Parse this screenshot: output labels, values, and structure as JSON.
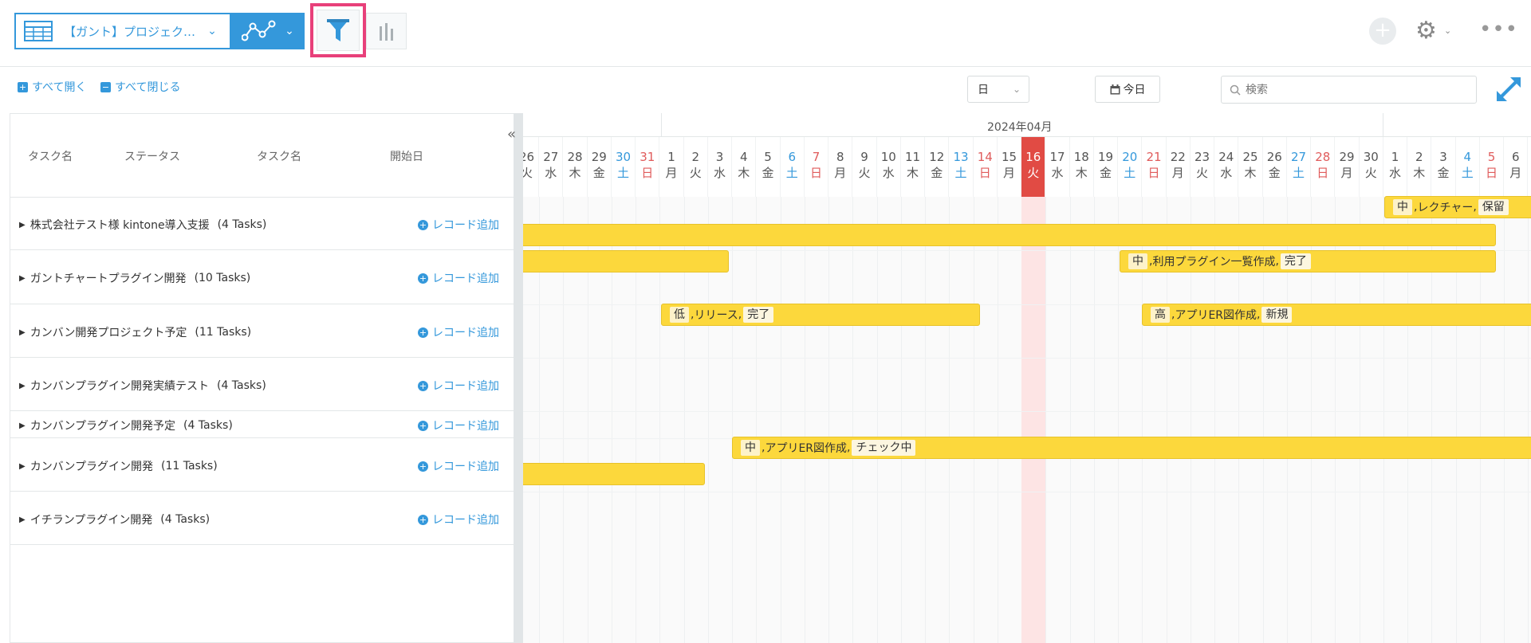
{
  "header": {
    "view_name": "【ガント】プロジェク…",
    "buttons": {
      "add": "+",
      "settings": "⚙",
      "more": "•••"
    }
  },
  "toolbar": {
    "expand_all": "すべて開く",
    "collapse_all": "すべて閉じる",
    "scale_select": "日",
    "today": "今日",
    "search_placeholder": "検索"
  },
  "columns": [
    "タスク名",
    "ステータス",
    "タスク名",
    "開始日"
  ],
  "groups": [
    {
      "name": "株式会社テスト様 kintone導入支援",
      "count": "(4 Tasks)",
      "add": "レコード追加"
    },
    {
      "name": "ガントチャートプラグイン開発",
      "count": "(10 Tasks)",
      "add": "レコード追加"
    },
    {
      "name": "カンバン開発プロジェクト予定",
      "count": "(11 Tasks)",
      "add": "レコード追加"
    },
    {
      "name": "カンバンプラグイン開発実績テスト",
      "count": "(4 Tasks)",
      "add": "レコード追加"
    },
    {
      "name": "カンバンプラグイン開発予定",
      "count": "(4 Tasks)",
      "add": "レコード追加"
    },
    {
      "name": "カンバンプラグイン開発",
      "count": "(11 Tasks)",
      "add": "レコード追加"
    },
    {
      "name": "イチランプラグイン開発",
      "count": "(4 Tasks)",
      "add": "レコード追加"
    }
  ],
  "timeline": {
    "month_label": "2024年04月",
    "days": [
      {
        "d": "26",
        "w": "火"
      },
      {
        "d": "27",
        "w": "水"
      },
      {
        "d": "28",
        "w": "木"
      },
      {
        "d": "29",
        "w": "金"
      },
      {
        "d": "30",
        "w": "土"
      },
      {
        "d": "31",
        "w": "日"
      },
      {
        "d": "1",
        "w": "月"
      },
      {
        "d": "2",
        "w": "火"
      },
      {
        "d": "3",
        "w": "水"
      },
      {
        "d": "4",
        "w": "木"
      },
      {
        "d": "5",
        "w": "金"
      },
      {
        "d": "6",
        "w": "土"
      },
      {
        "d": "7",
        "w": "日"
      },
      {
        "d": "8",
        "w": "月"
      },
      {
        "d": "9",
        "w": "火"
      },
      {
        "d": "10",
        "w": "水"
      },
      {
        "d": "11",
        "w": "木"
      },
      {
        "d": "12",
        "w": "金"
      },
      {
        "d": "13",
        "w": "土"
      },
      {
        "d": "14",
        "w": "日"
      },
      {
        "d": "15",
        "w": "月"
      },
      {
        "d": "16",
        "w": "火"
      },
      {
        "d": "17",
        "w": "水"
      },
      {
        "d": "18",
        "w": "木"
      },
      {
        "d": "19",
        "w": "金"
      },
      {
        "d": "20",
        "w": "土"
      },
      {
        "d": "21",
        "w": "日"
      },
      {
        "d": "22",
        "w": "月"
      },
      {
        "d": "23",
        "w": "火"
      },
      {
        "d": "24",
        "w": "水"
      },
      {
        "d": "25",
        "w": "木"
      },
      {
        "d": "26",
        "w": "金"
      },
      {
        "d": "27",
        "w": "土"
      },
      {
        "d": "28",
        "w": "日"
      },
      {
        "d": "29",
        "w": "月"
      },
      {
        "d": "30",
        "w": "火"
      },
      {
        "d": "1",
        "w": "水"
      },
      {
        "d": "2",
        "w": "木"
      },
      {
        "d": "3",
        "w": "金"
      },
      {
        "d": "4",
        "w": "土"
      },
      {
        "d": "5",
        "w": "日"
      },
      {
        "d": "6",
        "w": "月"
      }
    ],
    "today": "16"
  },
  "bars": [
    {
      "priority": "中",
      "name": "レクチャー",
      "status": "保留"
    },
    {
      "priority": "",
      "name": "",
      "status": ""
    },
    {
      "priority": "",
      "name": "",
      "status": ""
    },
    {
      "priority": "中",
      "name": "利用プラグイン一覧作成",
      "status": "完了"
    },
    {
      "priority": "",
      "name": "",
      "status": ""
    },
    {
      "priority": "低",
      "name": "リリース",
      "status": "完了"
    },
    {
      "priority": "高",
      "name": "アプリER図作成",
      "status": "新規"
    },
    {
      "priority": "中",
      "name": "アプリER図作成",
      "status": "チェック中"
    },
    {
      "priority": "",
      "name": "",
      "status": ""
    }
  ]
}
